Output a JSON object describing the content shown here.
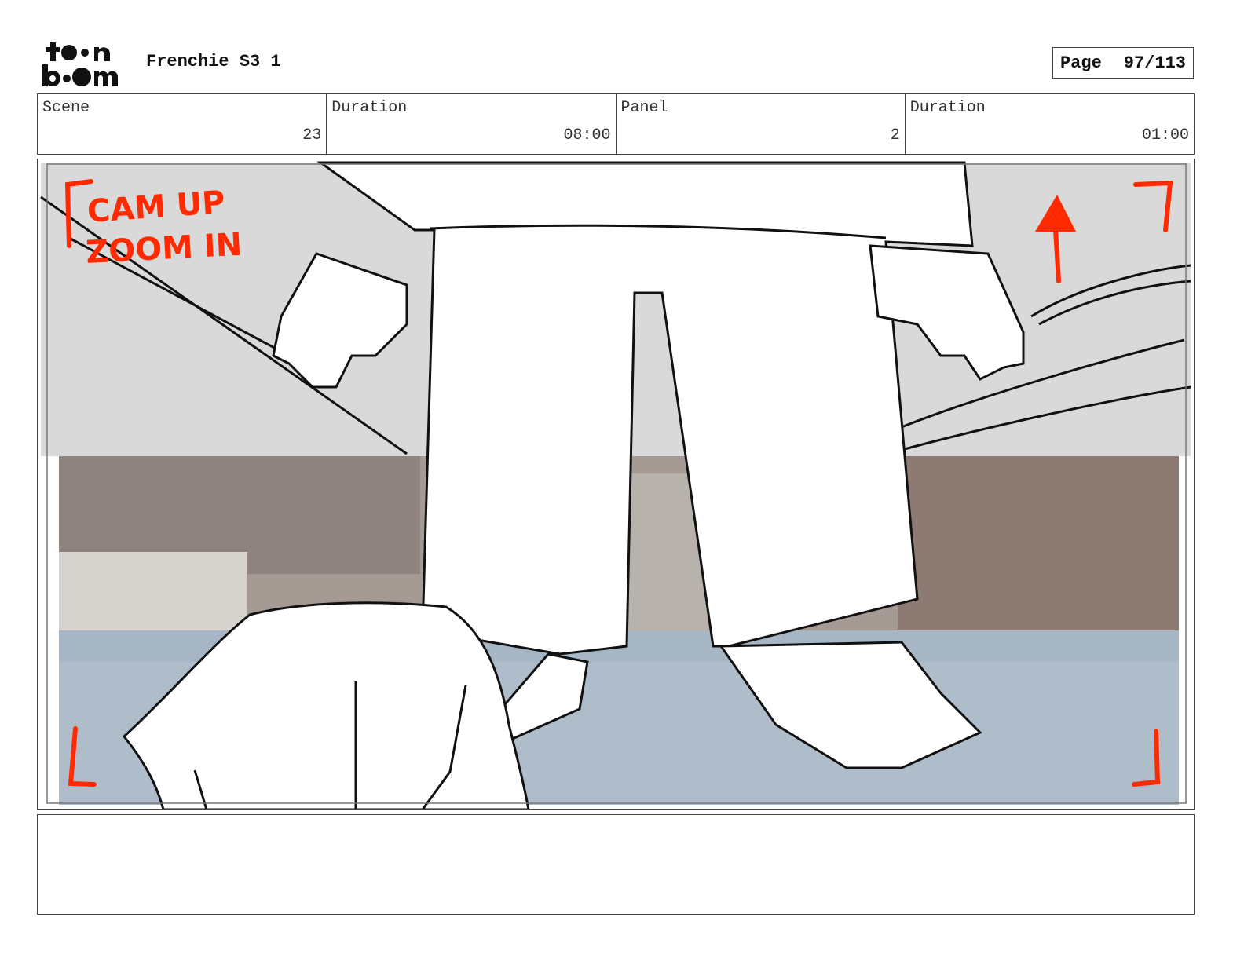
{
  "header": {
    "logo_top": "toon",
    "logo_bottom": "boom",
    "project_title": "Frenchie S3 1",
    "page_label": "Page",
    "page_number": "97/113"
  },
  "info": {
    "scene_label": "Scene",
    "scene_value": "23",
    "scene_duration_label": "Duration",
    "scene_duration_value": "08:00",
    "panel_label": "Panel",
    "panel_value": "2",
    "panel_duration_label": "Duration",
    "panel_duration_value": "01:00"
  },
  "panel": {
    "annotation_line1": "CAM UP",
    "annotation_line2": "ZOOM IN",
    "annotation_color": "#ff2a00"
  },
  "notes": {
    "text": ""
  }
}
